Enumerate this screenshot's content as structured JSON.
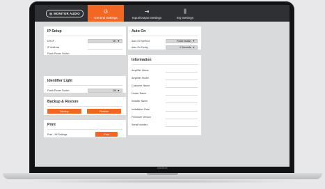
{
  "laptop": {
    "brand": "MacBook"
  },
  "header": {
    "logo_text": "MONITOR AUDIO",
    "tabs": [
      {
        "label": "General Settings",
        "icon": "settings-icon",
        "active": true
      },
      {
        "label": "Input/Output Settings",
        "icon": "input-output-icon",
        "active": false
      },
      {
        "label": "EQ Settings",
        "icon": "equalizer-icon",
        "active": false
      }
    ]
  },
  "ip_setup": {
    "title": "IP Setup",
    "dhcp_label": "DHCP",
    "dhcp_value": "On",
    "ip_address_label": "IP Address",
    "flash_label": "Flash Power Switch"
  },
  "identifier_light": {
    "title": "Identifier Light",
    "flash_label": "Flash Power Switch",
    "flash_value": "Off"
  },
  "backup_restore": {
    "title": "Backup & Restore",
    "backup_label": "Backup",
    "restore_label": "Restore"
  },
  "print": {
    "title": "Print",
    "row_label": "Print - All Settings",
    "button_label": "Print"
  },
  "auto_on": {
    "title": "Auto On",
    "method_label": "Auto On Method",
    "method_value": "Power Button",
    "delay_label": "Auto On Delay",
    "delay_value": "0 Seconds"
  },
  "information": {
    "title": "Information",
    "fields": [
      "Amplifier Name",
      "Amplifier Model",
      "Customer Name",
      "Dealer Name",
      "Installer Name",
      "Installation Date",
      "Firmware Version",
      "Serial Number"
    ]
  },
  "colors": {
    "accent": "#f26722",
    "header_bg": "#2f3033",
    "canvas_bg": "#d9dadc"
  }
}
